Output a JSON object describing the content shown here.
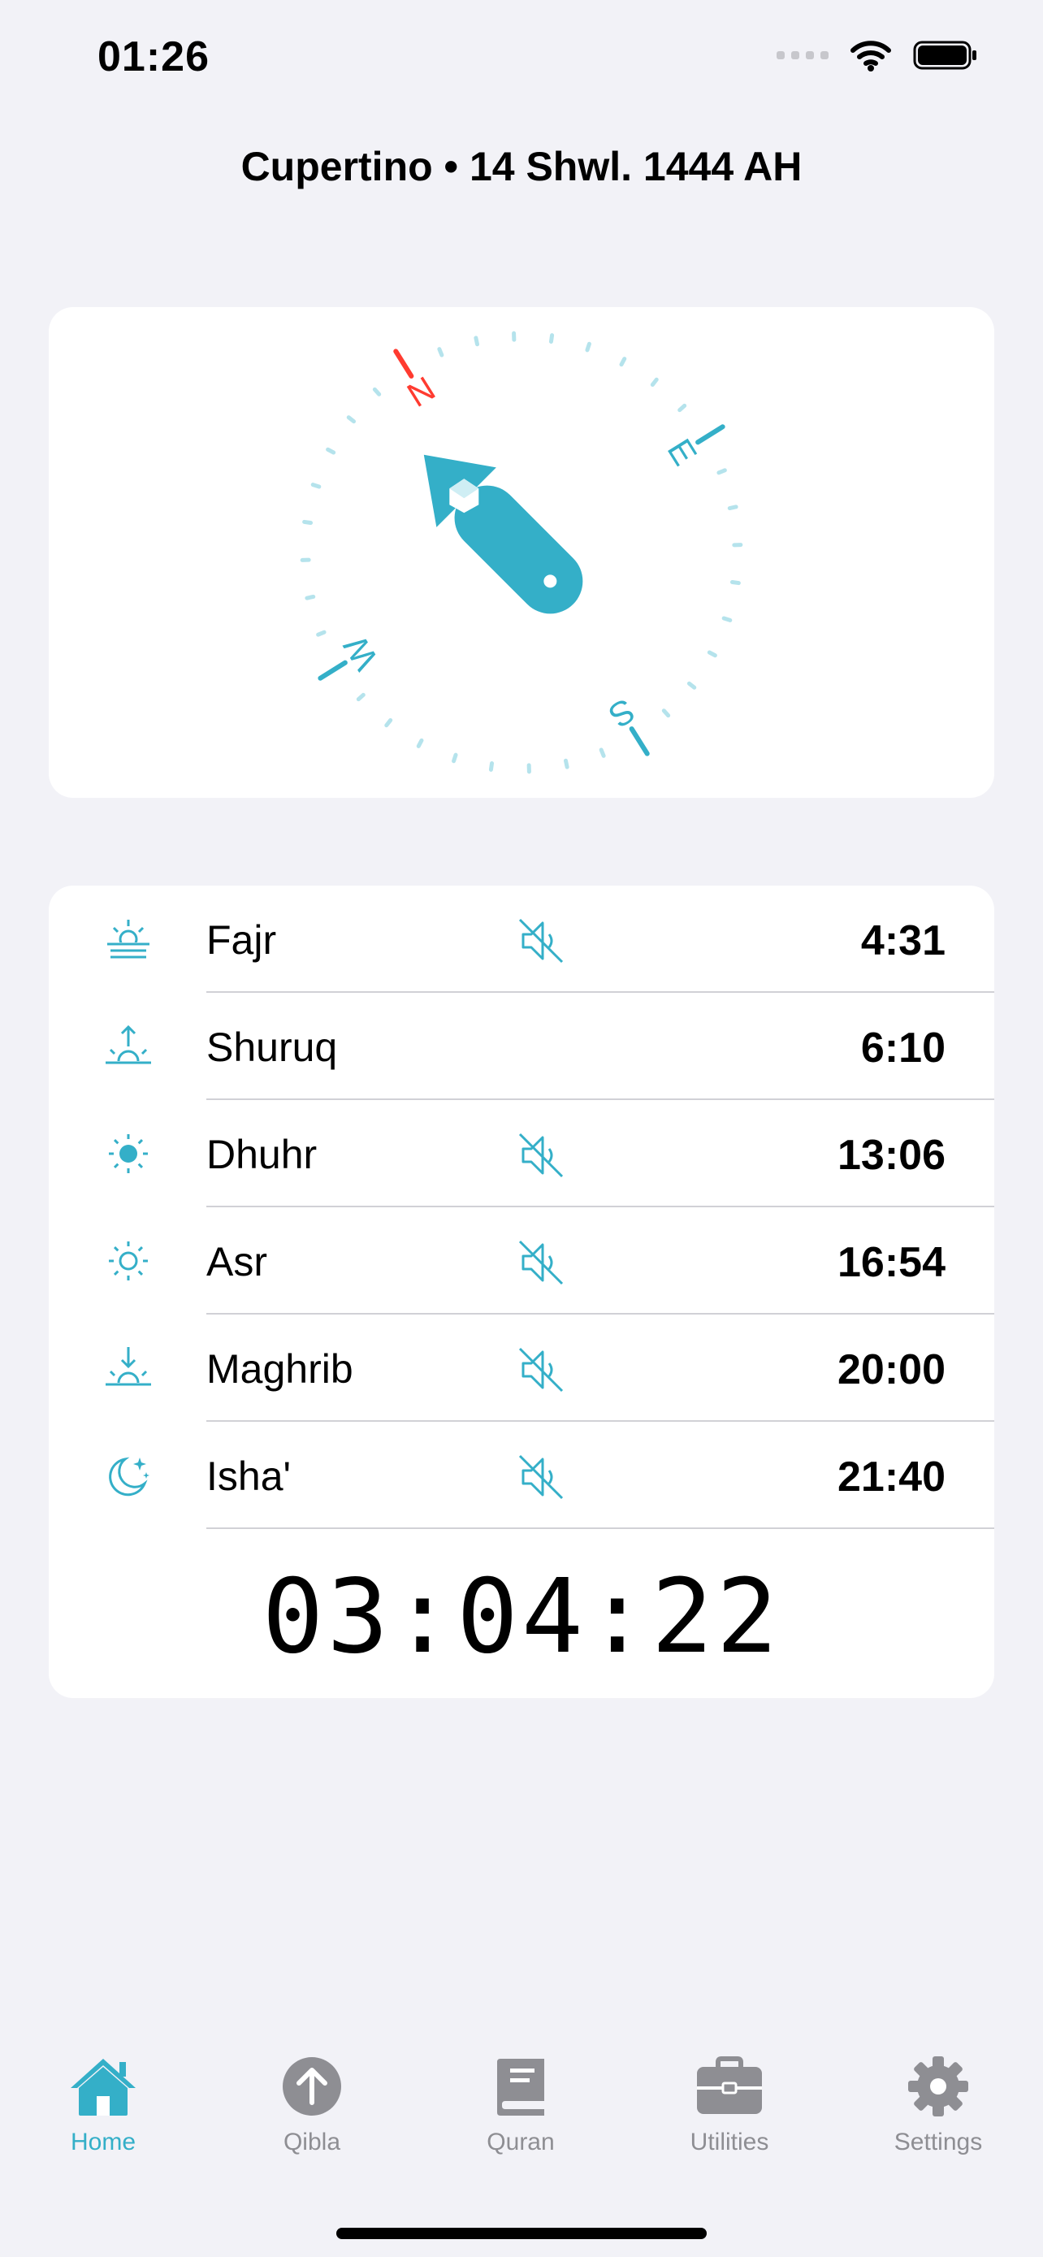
{
  "status_bar": {
    "time": "01:26"
  },
  "header": {
    "title": "Cupertino • 14 Shwl. 1444 AH"
  },
  "compass": {
    "labels": {
      "north": "N",
      "east": "E",
      "south": "S",
      "west": "W"
    },
    "accent_color": "#34AFC8",
    "north_color": "#FF3B30"
  },
  "prayers": [
    {
      "name": "Fajr",
      "time": "4:31",
      "icon": "sunrise-horizon-icon",
      "muted": true
    },
    {
      "name": "Shuruq",
      "time": "6:10",
      "icon": "sunrise-arrow-up-icon",
      "muted": false
    },
    {
      "name": "Dhuhr",
      "time": "13:06",
      "icon": "sun-filled-icon",
      "muted": true
    },
    {
      "name": "Asr",
      "time": "16:54",
      "icon": "sun-outline-icon",
      "muted": true
    },
    {
      "name": "Maghrib",
      "time": "20:00",
      "icon": "sunset-arrow-down-icon",
      "muted": true
    },
    {
      "name": "Isha'",
      "time": "21:40",
      "icon": "moon-stars-icon",
      "muted": true
    }
  ],
  "countdown": "03:04:22",
  "tabs": [
    {
      "label": "Home",
      "icon": "house-icon",
      "active": true
    },
    {
      "label": "Qibla",
      "icon": "arrow-up-circle-icon",
      "active": false
    },
    {
      "label": "Quran",
      "icon": "book-icon",
      "active": false
    },
    {
      "label": "Utilities",
      "icon": "briefcase-icon",
      "active": false
    },
    {
      "label": "Settings",
      "icon": "gear-icon",
      "active": false
    }
  ],
  "colors": {
    "accent": "#34AFC8",
    "inactive": "#8E8E93",
    "background": "#F2F2F7"
  }
}
